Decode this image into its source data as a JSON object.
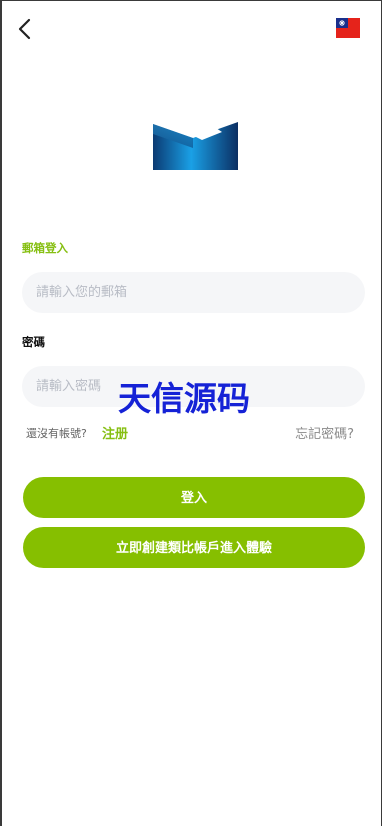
{
  "header": {
    "back_icon": "chevron-left-icon",
    "flag_icon": "taiwan-flag-icon"
  },
  "logo": {
    "icon": "brand-logo-icon",
    "colors": {
      "dark": "#0b2f63",
      "light": "#1aa0e6",
      "accent": "#4fbdf2"
    }
  },
  "form": {
    "email_label": "郵箱登入",
    "email_placeholder": "請輸入您的郵箱",
    "password_label": "密碼",
    "password_placeholder": "請輸入密碼"
  },
  "watermark": "天信源码",
  "links": {
    "no_account": "還沒有帳號?",
    "register": "注册",
    "forgot": "忘記密碼?"
  },
  "buttons": {
    "login": "登入",
    "demo": "立即創建類比帳戶進入體驗"
  },
  "colors": {
    "accent": "#86bf00",
    "input_bg": "#f5f6f8",
    "watermark": "#1522d6"
  }
}
